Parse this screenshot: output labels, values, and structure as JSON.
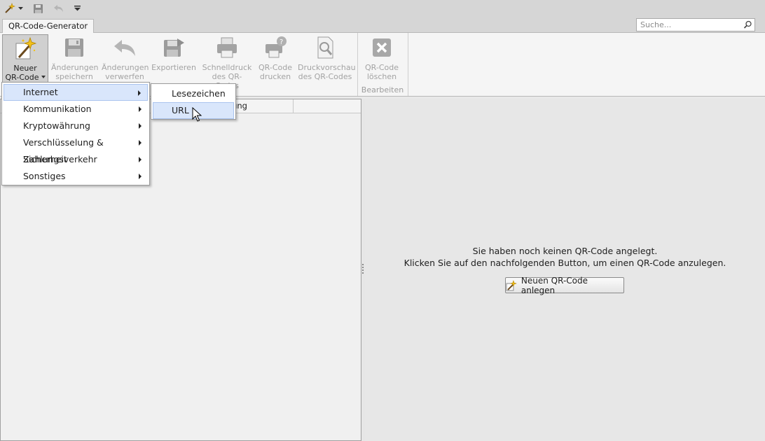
{
  "quick_access": {
    "icons": [
      "magic-wand-icon",
      "dropdown-caret-icon",
      "save-icon",
      "undo-icon",
      "customize-dropdown-icon"
    ]
  },
  "tabs": [
    {
      "label": "QR-Code-Generator",
      "active": true
    }
  ],
  "search": {
    "placeholder": "Suche..."
  },
  "ribbon": {
    "buttons": {
      "new": {
        "line1": "Neuer",
        "line2": "QR-Code"
      },
      "save": {
        "line1": "Änderungen",
        "line2": "speichern"
      },
      "discard": {
        "line1": "Änderungen",
        "line2": "verwerfen"
      },
      "export": {
        "line1": "Exportieren",
        "line2": ""
      },
      "quickprint": {
        "line1": "Schnelldruck",
        "line2": "des QR-Codes"
      },
      "print": {
        "line1": "QR-Code",
        "line2": "drucken"
      },
      "preview": {
        "line1": "Druckvorschau",
        "line2": "des QR-Codes"
      },
      "delete": {
        "line1": "QR-Code",
        "line2": "löschen"
      }
    },
    "groups": {
      "edit": "Bearbeiten"
    }
  },
  "grid": {
    "columns": {
      "remark": "erkung"
    }
  },
  "context_menu": {
    "items": [
      {
        "label": "Internet",
        "highlighted": true
      },
      {
        "label": "Kommunikation"
      },
      {
        "label": "Kryptowährung"
      },
      {
        "label": "Verschlüsselung & Sicherheit"
      },
      {
        "label": "Zahlungsverkehr"
      },
      {
        "label": "Sonstiges"
      }
    ],
    "submenu": [
      {
        "label": "Lesezeichen"
      },
      {
        "label": "URL",
        "highlighted": true
      }
    ]
  },
  "empty_state": {
    "line1": "Sie haben noch keinen QR-Code angelegt.",
    "line2": "Klicken Sie auf den nachfolgenden Button, um einen QR-Code anzulegen.",
    "button_label": "Neuen QR-Code anlegen"
  },
  "colors": {
    "highlight": "#d9e6fb",
    "highlight_border": "#aac4ee",
    "ribbon_bg": "#f5f5f5",
    "disabled_text": "#a3a3a3"
  }
}
